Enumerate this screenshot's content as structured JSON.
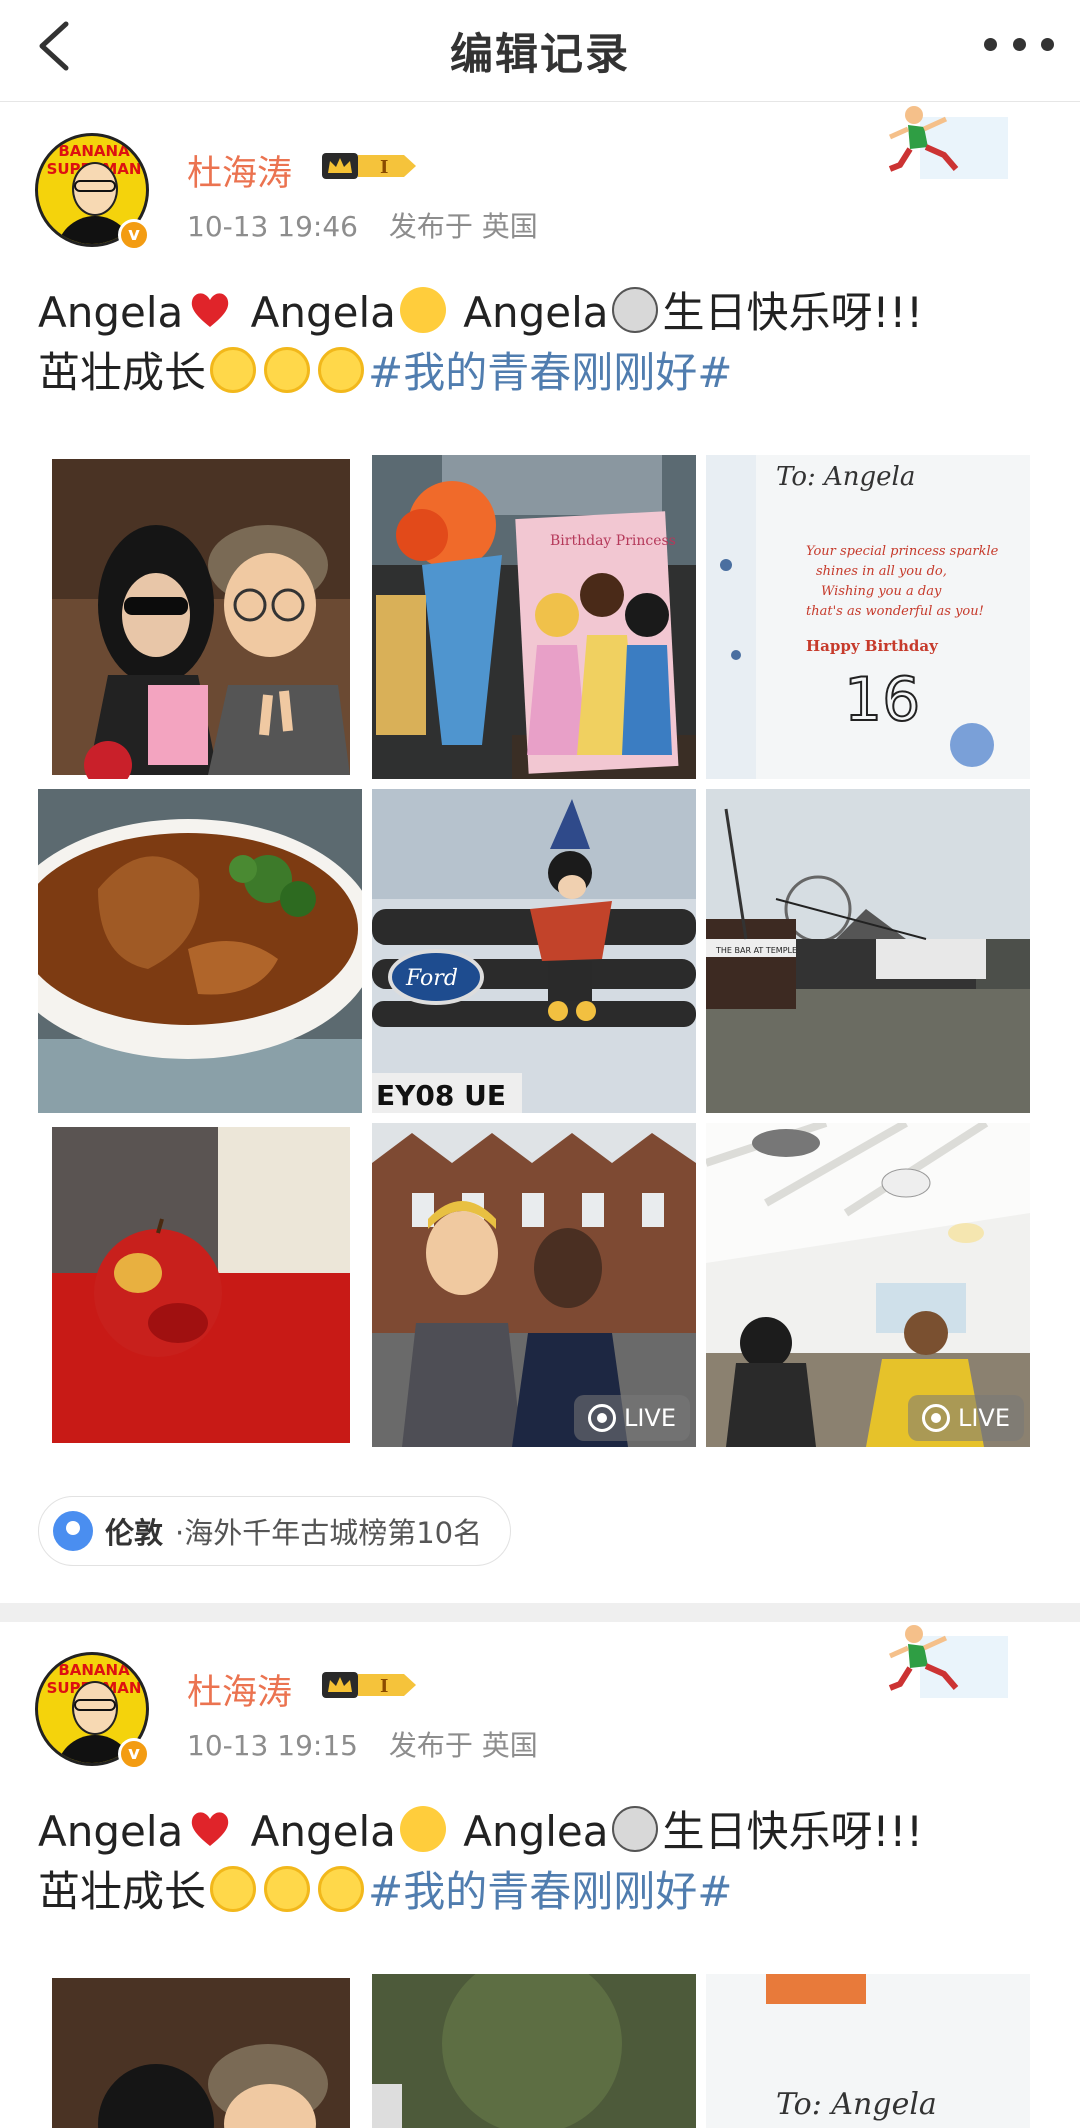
{
  "header": {
    "title": "编辑记录"
  },
  "posts": [
    {
      "username": "杜海涛",
      "time": "10-13 19:46",
      "location_text": "发布于 英国",
      "avatar_banner": "BANANA SUPERMAN",
      "text_parts": [
        "Angela",
        " Angela",
        " Angela",
        "生日快乐呀!!!",
        "茁壮成长",
        "#我的青春刚刚好#"
      ],
      "photos": [
        {
          "desc": "selfie-with-woman",
          "live": false
        },
        {
          "desc": "birthday-card-flowers",
          "live": false
        },
        {
          "desc": "card-text",
          "live": false
        },
        {
          "desc": "food-dish",
          "live": false
        },
        {
          "desc": "mickey-on-ford-grille",
          "live": false
        },
        {
          "desc": "thames-boats",
          "live": false
        },
        {
          "desc": "red-apple",
          "live": false
        },
        {
          "desc": "two-men-selfie",
          "live": true
        },
        {
          "desc": "classroom",
          "live": true
        }
      ],
      "card_lines": [
        "To: Angela",
        "Your special princess sparkle",
        "shines in all you do,",
        "Wishing you a day",
        "that's as wonderful as you!",
        "Happy Birthday",
        "16"
      ],
      "birthday_card_title": "Birthday Princess",
      "ford_logo": "Ford",
      "plate": "EY08 UE",
      "boat_text": "THE BAR AT TEMPLE",
      "live_label": "LIVE",
      "location": {
        "city": "伦敦",
        "detail": "·海外千年古城榜第10名"
      }
    },
    {
      "username": "杜海涛",
      "time": "10-13 19:15",
      "location_text": "发布于 英国",
      "avatar_banner": "BANANA SUPERMAN",
      "text_parts": [
        "Angela",
        " Angela",
        " Anglea",
        "生日快乐呀!!!",
        "茁壮成长",
        "#我的青春刚刚好#"
      ],
      "card_to": "To: Angela"
    }
  ],
  "colors": {
    "username": "#eb7350",
    "hashtag": "#507daf",
    "meta": "#8d8d8d",
    "location_pin": "#4a8ef0",
    "verified": "#f39c12"
  },
  "icons": [
    "back-arrow-icon",
    "more-dots-icon",
    "crown-badge-icon",
    "location-pin-icon",
    "live-photo-icon",
    "heart-emoji",
    "laughing-emoji",
    "cat-emoji",
    "sun-emoji"
  ]
}
